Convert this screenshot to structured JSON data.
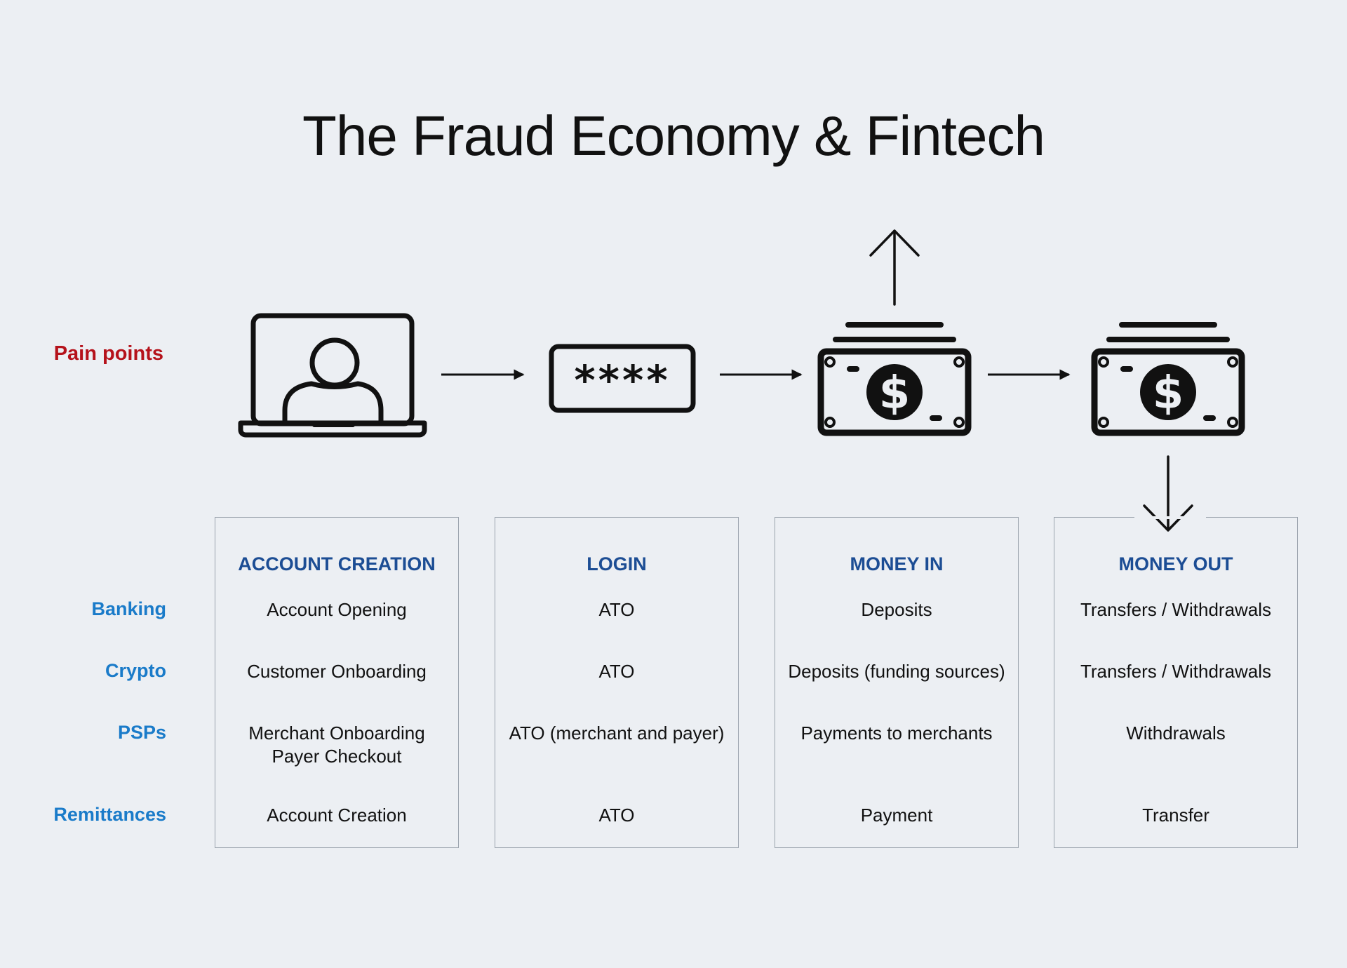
{
  "title": "The Fraud Economy & Fintech",
  "pain_points_label": "Pain points",
  "colors": {
    "background": "#eceff3",
    "pain_points": "#b5121b",
    "row_labels": "#1a7bc9",
    "column_heads": "#1c4d94",
    "icons": "#111111",
    "box_border": "#9ba3ad"
  },
  "icons": [
    "laptop-user-icon",
    "password-field-icon",
    "cash-stack-icon",
    "cash-stack-icon"
  ],
  "rows": [
    "Banking",
    "Crypto",
    "PSPs",
    "Remittances"
  ],
  "columns": [
    {
      "heading": "ACCOUNT CREATION",
      "cells": [
        "Account Opening",
        "Customer Onboarding",
        "Merchant Onboarding\nPayer Checkout",
        "Account Creation"
      ]
    },
    {
      "heading": "LOGIN",
      "cells": [
        "ATO",
        "ATO",
        "ATO (merchant and payer)",
        "ATO"
      ]
    },
    {
      "heading": "MONEY IN",
      "cells": [
        "Deposits",
        "Deposits (funding sources)",
        "Payments to merchants",
        "Payment"
      ]
    },
    {
      "heading": "MONEY OUT",
      "cells": [
        "Transfers / Withdrawals",
        "Transfers / Withdrawals",
        "Withdrawals",
        "Transfer"
      ]
    }
  ]
}
